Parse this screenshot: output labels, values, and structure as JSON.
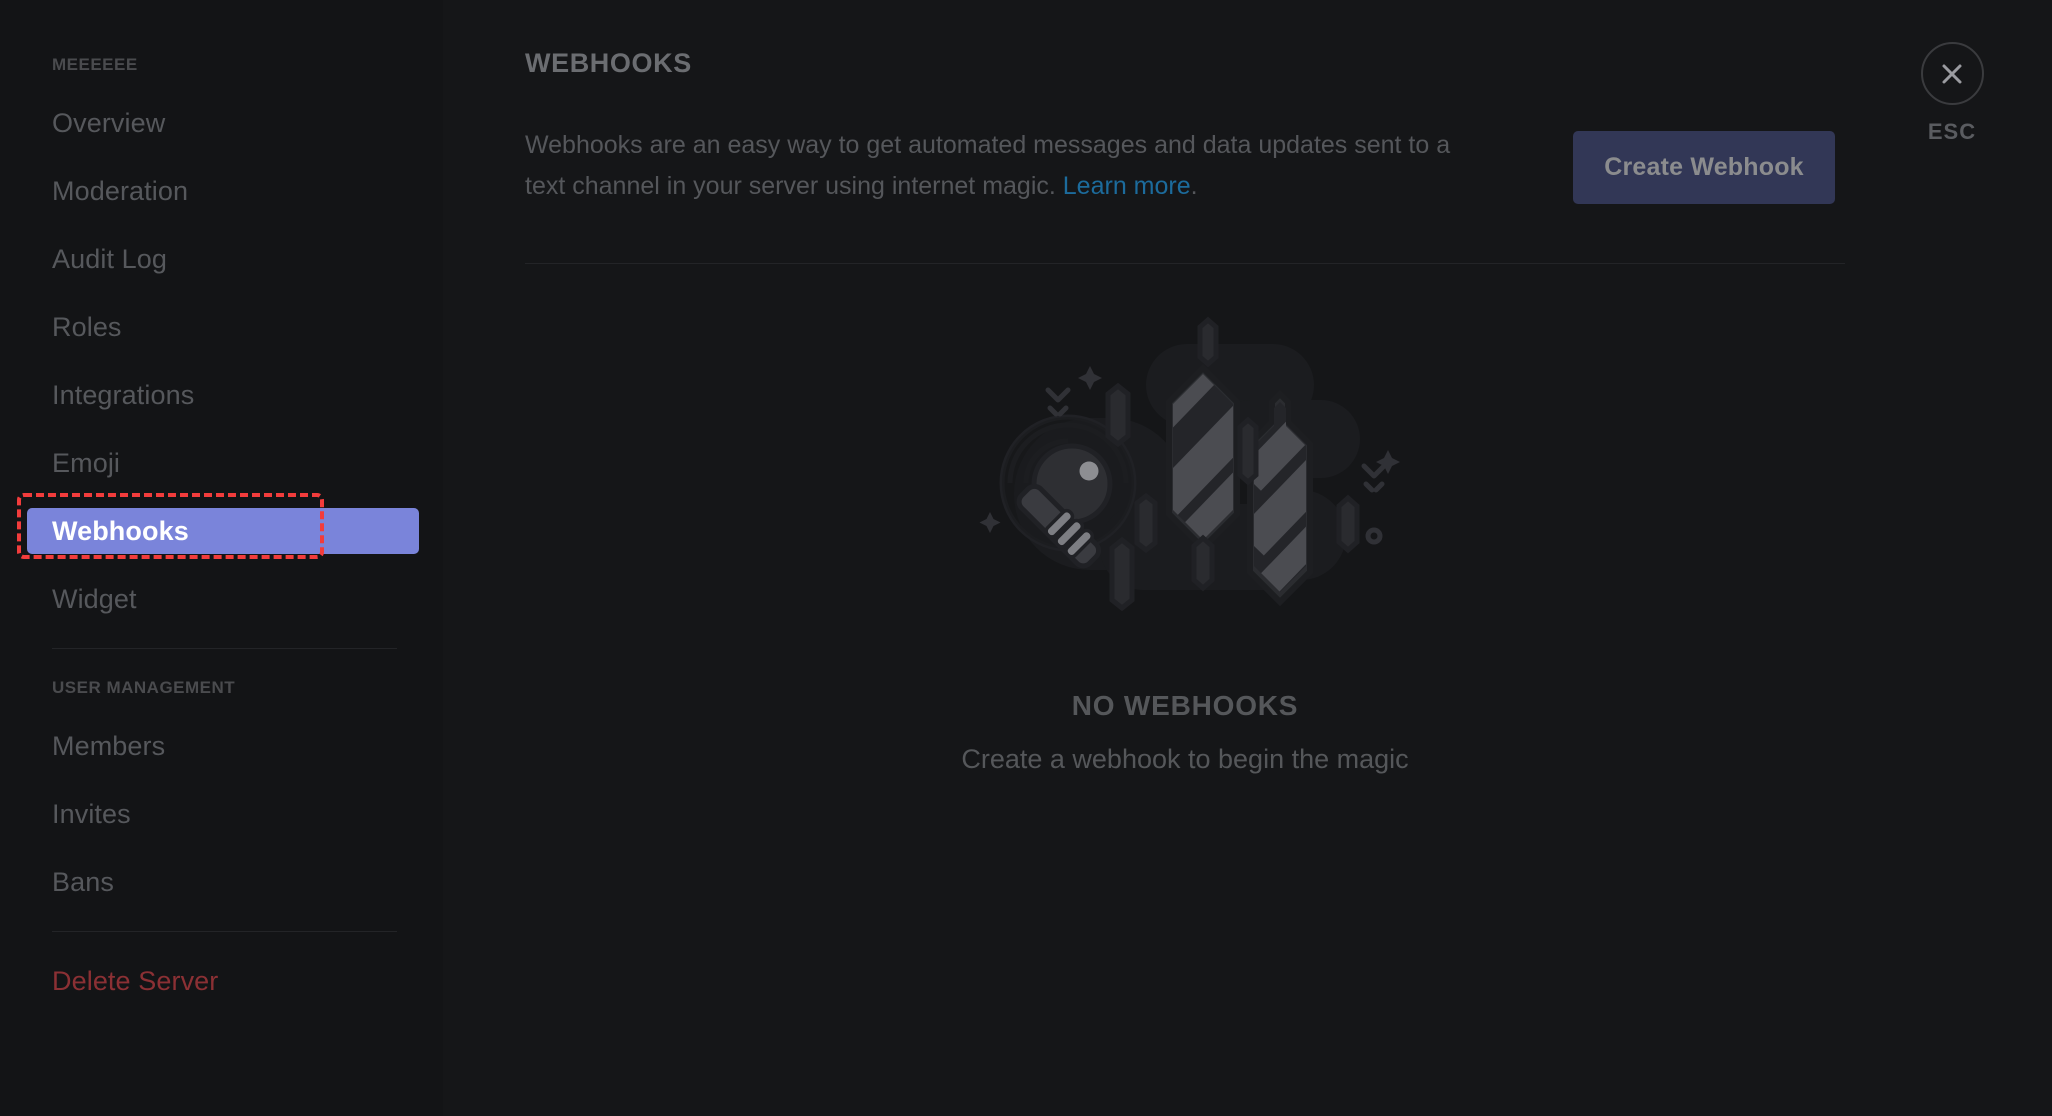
{
  "sidebar": {
    "server_name": "MEEEEEE",
    "server_items": [
      {
        "label": "Overview"
      },
      {
        "label": "Moderation"
      },
      {
        "label": "Audit Log"
      },
      {
        "label": "Roles"
      },
      {
        "label": "Integrations"
      },
      {
        "label": "Emoji"
      },
      {
        "label": "Webhooks"
      },
      {
        "label": "Widget"
      }
    ],
    "user_management_header": "USER MANAGEMENT",
    "user_management_items": [
      {
        "label": "Members"
      },
      {
        "label": "Invites"
      },
      {
        "label": "Bans"
      }
    ],
    "delete_server_label": "Delete Server",
    "active_item": "Webhooks",
    "active_bg_color": "#7a84da",
    "annotation_color": "#f23c3c"
  },
  "header": {
    "title": "WEBHOOKS",
    "description_part1": "Webhooks are an easy way to get automated messages and data updates sent to a text channel in your server using internet magic. ",
    "learn_more_label": "Learn more",
    "description_part2": ".",
    "learn_more_color": "#1c6b9c"
  },
  "toolbar": {
    "create_webhook_label": "Create Webhook",
    "create_webhook_color": "#323756"
  },
  "empty_state": {
    "title": "NO WEBHOOKS",
    "subtitle": "Create a webhook to begin the magic",
    "illustration_name": "magic-wand-crystals-illustration"
  },
  "close": {
    "icon": "close-icon",
    "label": "ESC"
  }
}
